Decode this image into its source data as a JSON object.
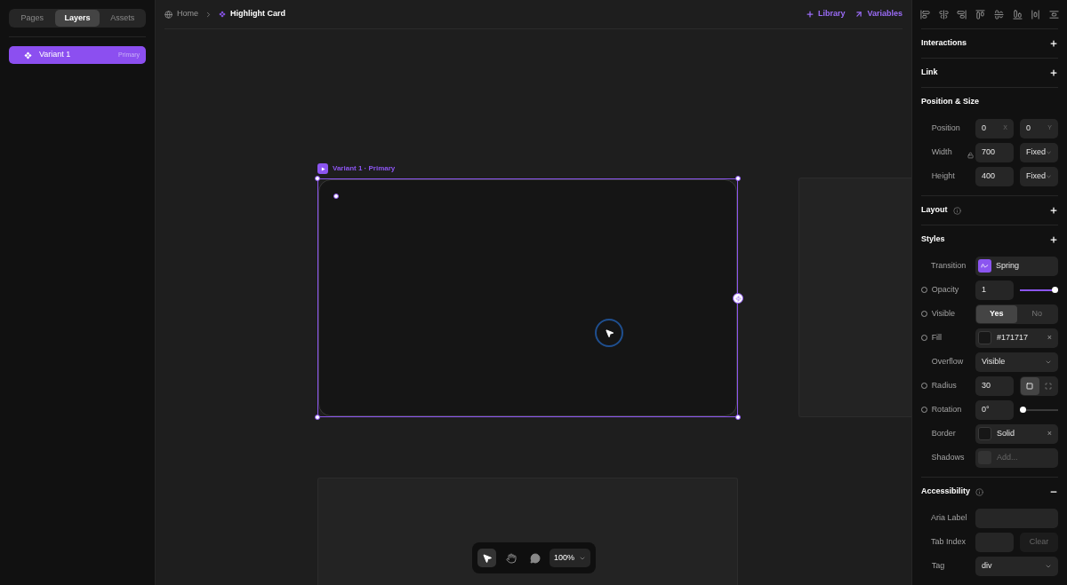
{
  "sidebar": {
    "tabs": [
      {
        "label": "Pages",
        "selected": false
      },
      {
        "label": "Layers",
        "selected": true
      },
      {
        "label": "Assets",
        "selected": false
      }
    ],
    "layers": [
      {
        "name": "Variant 1",
        "badge": "Primary",
        "selected": true
      }
    ]
  },
  "breadcrumb": [
    {
      "label": "Home",
      "kind": "globe"
    },
    {
      "label": "Highlight Card",
      "kind": "component"
    }
  ],
  "top_actions": [
    {
      "label": "Library",
      "kind": "plus"
    },
    {
      "label": "Variables",
      "kind": "arrow"
    }
  ],
  "canvas": {
    "frame_label": "Variant 1 · Primary"
  },
  "toolbar": {
    "tools": [
      {
        "kind": "pointer",
        "selected": true
      },
      {
        "kind": "hand",
        "selected": false
      },
      {
        "kind": "comment",
        "selected": false
      }
    ],
    "zoom": "100%"
  },
  "inspector": {
    "sections": [
      {
        "title": "Interactions",
        "expanded": false
      },
      {
        "title": "Link",
        "expanded": false
      },
      {
        "title": "Position & Size",
        "aspect_locked": false,
        "rows": [
          {
            "kind": "pair",
            "label": "Position",
            "a": "0",
            "a_unit": "X",
            "b": "0",
            "b_unit": "Y"
          },
          {
            "kind": "size",
            "label": "Width",
            "value": "700",
            "mode": "Fixed"
          },
          {
            "kind": "size",
            "label": "Height",
            "value": "400",
            "mode": "Fixed"
          }
        ]
      },
      {
        "title": "Layout",
        "info": true,
        "expanded": false
      },
      {
        "title": "Styles",
        "expanded": false,
        "rows": [
          {
            "kind": "transition",
            "label": "Transition",
            "value": "Spring"
          },
          {
            "kind": "slider",
            "label": "Opacity",
            "bound": true,
            "value": "1",
            "level": 1
          },
          {
            "kind": "toggle",
            "label": "Visible",
            "bound": true,
            "options": [
              {
                "label": "Yes",
                "selected": true
              },
              {
                "label": "No",
                "selected": false
              }
            ]
          },
          {
            "kind": "color",
            "label": "Fill",
            "bound": true,
            "value": "#171717",
            "clear": "×"
          },
          {
            "kind": "select",
            "label": "Overflow",
            "value": "Visible"
          },
          {
            "kind": "radius",
            "label": "Radius",
            "bound": true,
            "value": "30",
            "modes": [
              {
                "kind": "uniform",
                "selected": true
              },
              {
                "kind": "individual",
                "selected": false
              }
            ]
          },
          {
            "kind": "slider",
            "label": "Rotation",
            "bound": true,
            "value": "0°",
            "level": 0
          },
          {
            "kind": "color",
            "label": "Border",
            "value": "Solid",
            "clear": "×"
          },
          {
            "kind": "shadow",
            "label": "Shadows",
            "placeholder": "Add..."
          }
        ]
      },
      {
        "title": "Accessibility",
        "info": true,
        "expanded": true,
        "rows": [
          {
            "kind": "text",
            "label": "Aria Label"
          },
          {
            "kind": "clearable",
            "label": "Tab Index",
            "button": "Clear"
          },
          {
            "kind": "select",
            "label": "Tag",
            "value": "div"
          }
        ]
      }
    ]
  }
}
